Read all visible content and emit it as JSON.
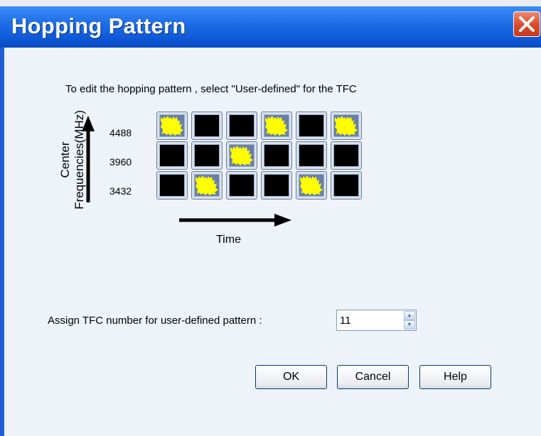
{
  "dialog": {
    "title": "Hopping Pattern",
    "instruction": "To edit the hopping pattern , select \"User-defined\" for the TFC",
    "y_axis_label_line1": "Center",
    "y_axis_label_line2": "Frequencies(MHz)",
    "x_axis_label": "Time",
    "frequencies": [
      "4488",
      "3960",
      "3432"
    ],
    "pattern_grid": [
      [
        true,
        false,
        false,
        true,
        false,
        true
      ],
      [
        false,
        false,
        true,
        false,
        false,
        false
      ],
      [
        false,
        true,
        false,
        false,
        true,
        false
      ]
    ],
    "tfc_label": "Assign TFC number for user-defined pattern :",
    "tfc_value": "11",
    "buttons": {
      "ok": "OK",
      "cancel": "Cancel",
      "help": "Help"
    }
  },
  "colors": {
    "title_bar": "#0d57d6",
    "active_cell": "#ffff00",
    "inactive_cell": "#000000",
    "background": "#eef3fa"
  },
  "icons": {
    "close": "close-x-icon",
    "up_arrow": "arrow-up-icon",
    "right_arrow": "arrow-right-icon"
  }
}
